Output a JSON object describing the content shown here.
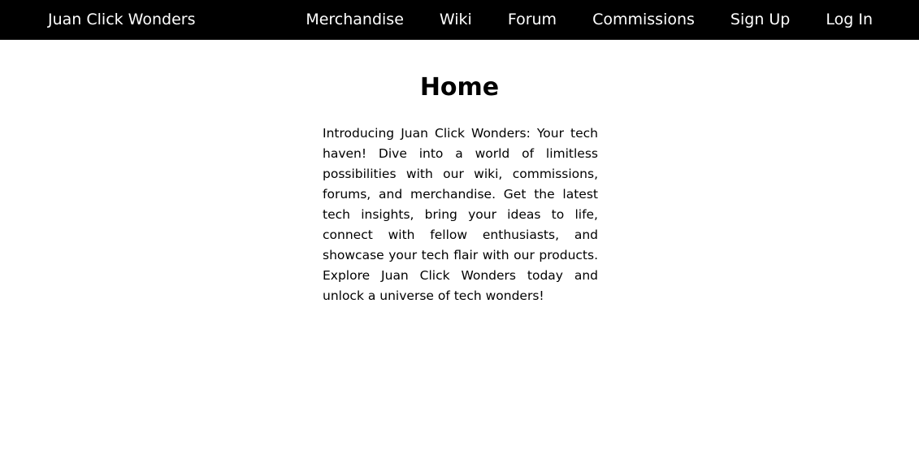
{
  "navbar": {
    "brand": "Juan Click Wonders",
    "links": [
      {
        "label": "Merchandise"
      },
      {
        "label": "Wiki"
      },
      {
        "label": "Forum"
      },
      {
        "label": "Commissions"
      },
      {
        "label": "Sign Up"
      },
      {
        "label": "Log In"
      }
    ]
  },
  "main": {
    "title": "Home",
    "intro": "Introducing Juan Click Wonders: Your tech haven! Dive into a world of limitless possibilities with our wiki, commissions, forums, and merchandise. Get the latest tech insights, bring your ideas to life, connect with fellow enthusiasts, and showcase your tech flair with our products. Explore Juan Click Wonders today and unlock a universe of tech wonders!"
  },
  "colors": {
    "navbar_background": "#000000",
    "navbar_text": "#ffffff",
    "page_background": "#ffffff",
    "body_text": "#000000"
  }
}
